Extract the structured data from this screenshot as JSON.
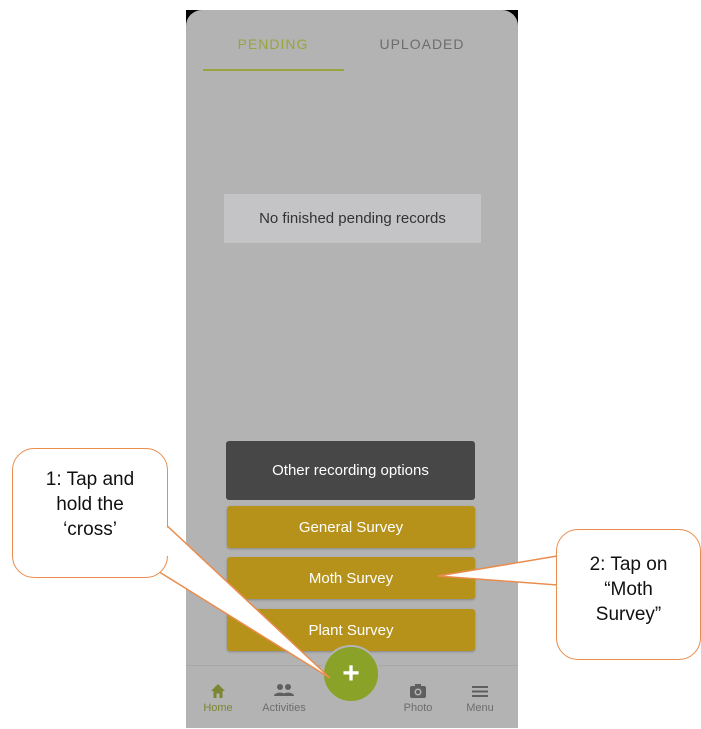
{
  "tabs": [
    {
      "label": "PENDING",
      "active": true
    },
    {
      "label": "UPLOADED",
      "active": false
    }
  ],
  "empty_message": "No finished pending records",
  "other_options_label": "Other recording options",
  "surveys": [
    {
      "label": "General Survey"
    },
    {
      "label": "Moth Survey"
    },
    {
      "label": "Plant Survey"
    }
  ],
  "fab_label": "+",
  "nav": [
    {
      "label": "Home",
      "icon": "home-icon"
    },
    {
      "label": "Activities",
      "icon": "people-icon"
    },
    {
      "label": "Photo",
      "icon": "camera-icon"
    },
    {
      "label": "Menu",
      "icon": "menu-icon"
    }
  ],
  "callouts": {
    "step1": [
      "1: Tap and",
      "hold the",
      "‘cross’"
    ],
    "step2": [
      "2: Tap on",
      "“Moth",
      "Survey”"
    ]
  },
  "colors": {
    "accent_green": "#9aa43d",
    "fab_green": "#8aa227",
    "survey_gold": "#b6921a",
    "dark_button": "#474747",
    "background_gray": "#b3b3b3",
    "callout_border": "#e98d4e"
  }
}
